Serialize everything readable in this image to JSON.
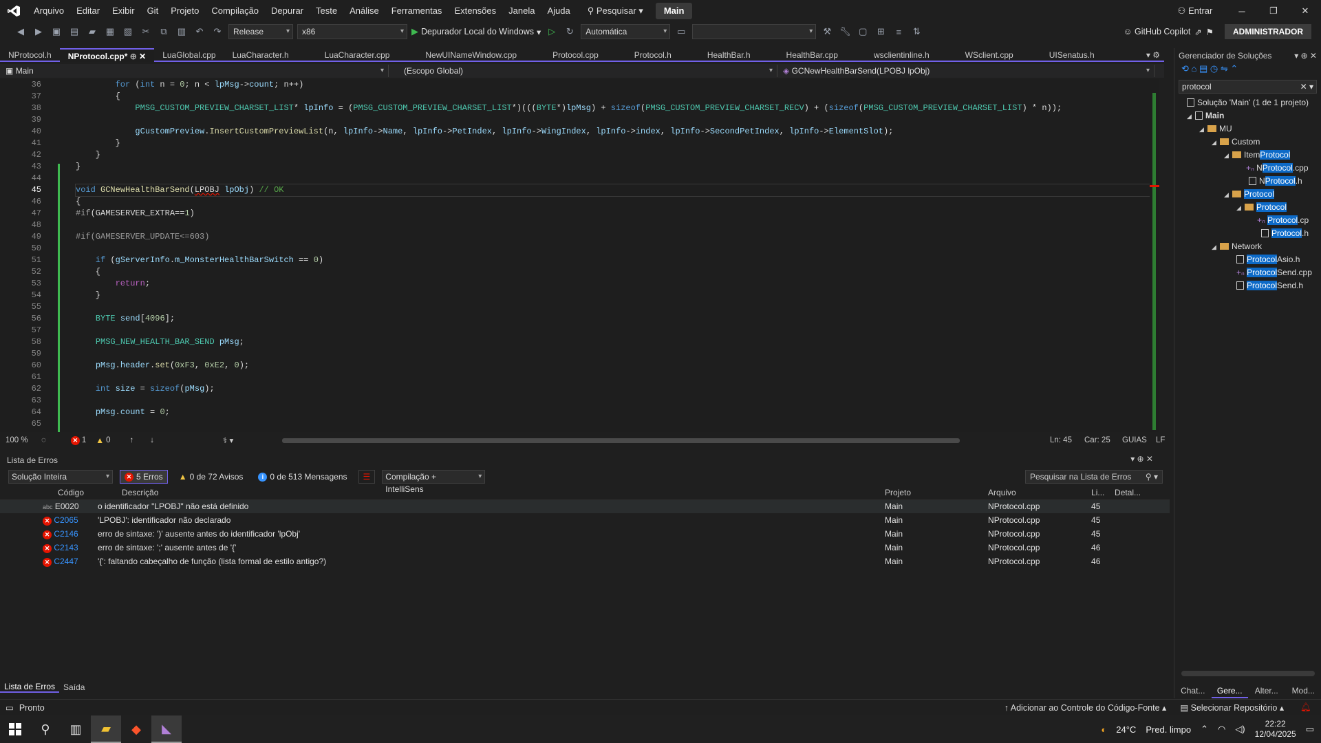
{
  "menu": {
    "items": [
      "Arquivo",
      "Editar",
      "Exibir",
      "Git",
      "Projeto",
      "Compilação",
      "Depurar",
      "Teste",
      "Análise",
      "Ferramentas",
      "Extensões",
      "Janela",
      "Ajuda"
    ],
    "search": "Pesquisar",
    "solution_name": "Main",
    "signin": "Entrar"
  },
  "toolbar": {
    "config": "Release",
    "platform": "x86",
    "debugger": "Depurador Local do Windows",
    "auto": "Automática",
    "copilot": "GitHub Copilot",
    "admin": "ADMINISTRADOR"
  },
  "tabs": [
    "NProtocol.h",
    "NProtocol.cpp*",
    "LuaGlobal.cpp",
    "LuaCharacter.h",
    "LuaCharacter.cpp",
    "NewUINameWindow.cpp",
    "Protocol.cpp",
    "Protocol.h",
    "HealthBar.h",
    "HealthBar.cpp",
    "wsclientinline.h",
    "WSclient.cpp",
    "UISenatus.h"
  ],
  "navbar": {
    "project": "Main",
    "scope": "(Escopo Global)",
    "function": "GCNewHealthBarSend(LPOBJ lpObj)"
  },
  "editor": {
    "line_numbers": [
      "36",
      "37",
      "38",
      "39",
      "40",
      "41",
      "42",
      "43",
      "44",
      "45",
      "46",
      "47",
      "48",
      "49",
      "50",
      "51",
      "52",
      "53",
      "54",
      "55",
      "56",
      "57",
      "58",
      "59",
      "60",
      "61",
      "62",
      "63",
      "64",
      "65"
    ],
    "status": {
      "zoom": "100 %",
      "errors": "1",
      "warnings": "0",
      "line": "Ln: 45",
      "col": "Car: 25",
      "guides": "GUIAS",
      "eol": "LF"
    }
  },
  "errors": {
    "title": "Lista de Erros",
    "scope": "Solução Inteira",
    "err_count": "5 Erros",
    "warn_count": "0 de 72 Avisos",
    "msg_count": "0 de 513 Mensagens",
    "build": "Compilação + IntelliSens",
    "search_placeholder": "Pesquisar na Lista de Erros",
    "headers": [
      "Código",
      "Descrição",
      "Projeto",
      "Arquivo",
      "Li...",
      "Detal..."
    ],
    "rows": [
      {
        "code": "E0020",
        "desc": "o identificador \"LPOBJ\" não está definido",
        "proj": "Main",
        "file": "NProtocol.cpp",
        "line": "45"
      },
      {
        "code": "C2065",
        "desc": "'LPOBJ': identificador não declarado",
        "proj": "Main",
        "file": "NProtocol.cpp",
        "line": "45"
      },
      {
        "code": "C2146",
        "desc": "erro de sintaxe: ')' ausente antes do identificador 'lpObj'",
        "proj": "Main",
        "file": "NProtocol.cpp",
        "line": "45"
      },
      {
        "code": "C2143",
        "desc": "erro de sintaxe: ';' ausente antes de '{'",
        "proj": "Main",
        "file": "NProtocol.cpp",
        "line": "46"
      },
      {
        "code": "C2447",
        "desc": "'{': faltando cabeçalho de função (lista formal de estilo antigo?)",
        "proj": "Main",
        "file": "NProtocol.cpp",
        "line": "46"
      }
    ],
    "tab_errors": "Lista de Erros",
    "tab_output": "Saída"
  },
  "solution_explorer": {
    "title": "Gerenciador de Soluções",
    "search": "protocol",
    "solution": "Solução 'Main' (1 de 1 projeto)",
    "tabs": [
      "Chat...",
      "Gere...",
      "Alter...",
      "Mod..."
    ]
  },
  "status": {
    "ready": "Pronto",
    "source_control": "Adicionar ao Controle do Código-Fonte",
    "repo": "Selecionar Repositório"
  },
  "taskbar": {
    "temp": "24°C",
    "weather": "Pred. limpo",
    "time": "22:22",
    "date": "12/04/2025"
  }
}
